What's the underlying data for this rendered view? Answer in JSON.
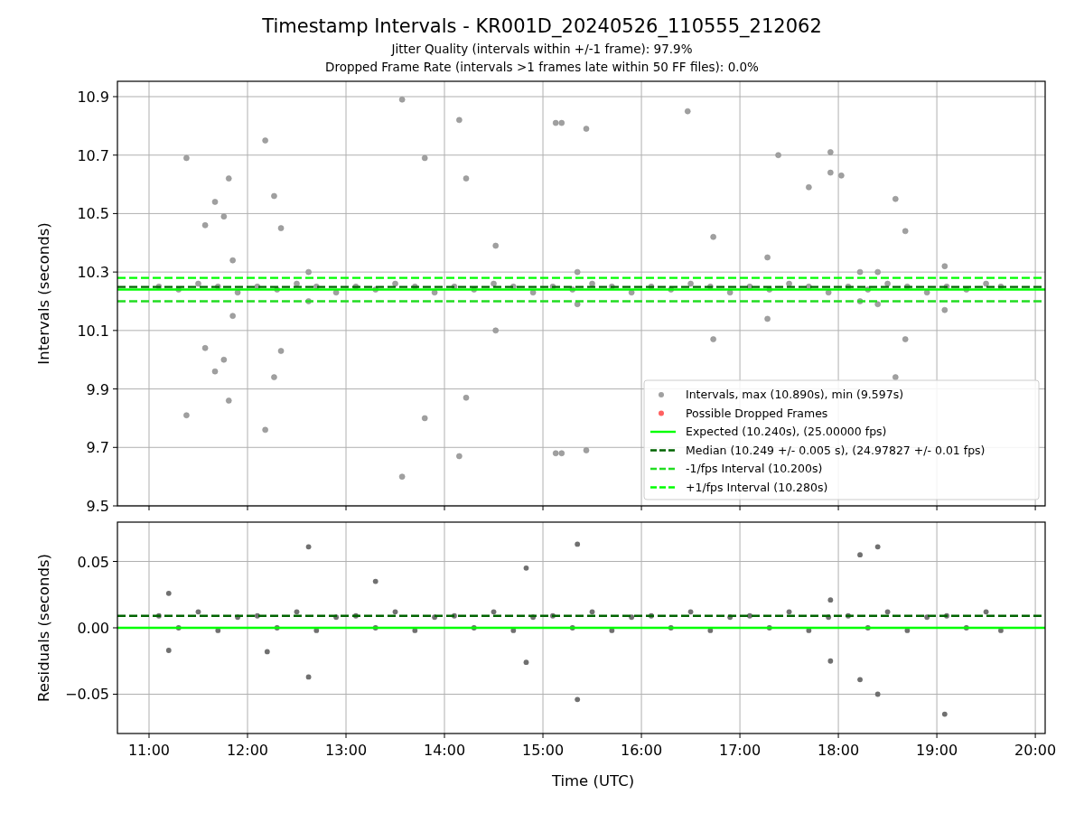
{
  "title": "Timestamp Intervals - KR001D_20240526_110555_212062",
  "subtitles": [
    "Jitter Quality (intervals within +/-1 frame): 97.9%",
    "Dropped Frame Rate (intervals >1 frames late within 50 FF files): 0.0%"
  ],
  "charts": [
    {
      "chart_data": {
        "type": "scatter",
        "ylabel": "Intervals (seconds)",
        "xlim": [
          10.679,
          20.1
        ],
        "ylim": [
          9.5,
          10.9525
        ],
        "yticks": [
          {
            "value": 9.5,
            "label": "9.5"
          },
          {
            "value": 9.7,
            "label": "9.7"
          },
          {
            "value": 9.9,
            "label": "9.9"
          },
          {
            "value": 10.1,
            "label": "10.1"
          },
          {
            "value": 10.3,
            "label": "10.3"
          },
          {
            "value": 10.5,
            "label": "10.5"
          },
          {
            "value": 10.7,
            "label": "10.7"
          },
          {
            "value": 10.9,
            "label": "10.9"
          }
        ],
        "series": [
          {
            "name": "Intervals, max (10.890s), min (9.597s)",
            "color": "#a0a0a0",
            "x": [
              11.38,
              11.38,
              11.57,
              11.57,
              11.67,
              11.67,
              11.76,
              11.76,
              11.81,
              11.81,
              11.85,
              11.85,
              12.18,
              12.18,
              12.27,
              12.27,
              12.34,
              12.34,
              12.62,
              12.62,
              13.57,
              13.57,
              13.8,
              13.8,
              14.15,
              14.15,
              14.22,
              14.22,
              14.52,
              14.52,
              15.13,
              15.13,
              15.19,
              15.19,
              15.35,
              15.35,
              15.44,
              15.44,
              16.47,
              16.73,
              16.73,
              17.28,
              17.28,
              17.39,
              17.7,
              17.92,
              17.92,
              18.03,
              18.22,
              18.22,
              18.4,
              18.4,
              18.58,
              18.58,
              18.68,
              18.68,
              19.08,
              19.08,
              11.1,
              11.3,
              11.5,
              11.7,
              11.9,
              12.1,
              12.3,
              12.5,
              12.7,
              12.9,
              13.1,
              13.3,
              13.5,
              13.7,
              13.9,
              14.1,
              14.3,
              14.5,
              14.7,
              14.9,
              15.1,
              15.3,
              15.5,
              15.7,
              15.9,
              16.1,
              16.3,
              16.5,
              16.7,
              16.9,
              17.1,
              17.3,
              17.5,
              17.7,
              17.9,
              18.1,
              18.3,
              18.5,
              18.7,
              18.9,
              19.1,
              19.3,
              19.5,
              19.65
            ],
            "values": [
              10.69,
              9.81,
              10.46,
              10.04,
              10.54,
              9.96,
              10.49,
              10.0,
              10.62,
              9.86,
              10.34,
              10.15,
              10.75,
              9.76,
              10.56,
              9.94,
              10.45,
              10.03,
              10.3,
              10.2,
              10.89,
              9.6,
              10.69,
              9.8,
              10.82,
              9.67,
              10.62,
              9.87,
              10.39,
              10.1,
              10.81,
              9.68,
              10.81,
              9.68,
              10.3,
              10.19,
              10.79,
              9.69,
              10.85,
              10.42,
              10.07,
              10.35,
              10.14,
              10.7,
              10.59,
              10.71,
              10.64,
              10.63,
              10.3,
              10.2,
              10.3,
              10.19,
              10.55,
              9.94,
              10.44,
              10.07,
              10.32,
              10.17,
              10.25,
              10.24,
              10.26,
              10.25,
              10.23,
              10.25,
              10.24,
              10.26,
              10.25,
              10.23,
              10.25,
              10.24,
              10.26,
              10.25,
              10.23,
              10.25,
              10.24,
              10.26,
              10.25,
              10.23,
              10.25,
              10.24,
              10.26,
              10.25,
              10.23,
              10.25,
              10.24,
              10.26,
              10.25,
              10.23,
              10.25,
              10.24,
              10.26,
              10.25,
              10.23,
              10.25,
              10.24,
              10.26,
              10.25,
              10.23,
              10.25,
              10.24,
              10.26,
              10.25
            ]
          },
          {
            "name": "Possible Dropped Frames",
            "color": "#ff6060"
          },
          {
            "name": "Expected (10.240s), (25.00000 fps)",
            "type": "line",
            "color": "#00ff00",
            "x": [
              10.679,
              20.1
            ],
            "values": [
              10.24,
              10.24
            ]
          },
          {
            "name": "Median (10.249 +/- 0.005 s), (24.97827 +/- 0.01 fps)",
            "type": "line",
            "line_style": "dashed",
            "color": "#006400",
            "x": [
              10.679,
              20.1
            ],
            "values": [
              10.249,
              10.249
            ]
          },
          {
            "name": "-1/fps Interval (10.200s)",
            "type": "line",
            "line_style": "dashed",
            "color": "#22dd22",
            "x": [
              10.679,
              20.1
            ],
            "values": [
              10.2,
              10.2
            ]
          },
          {
            "name": "+1/fps Interval (10.280s)",
            "type": "line",
            "line_style": "dashed",
            "color": "#00ff00",
            "x": [
              10.679,
              20.1
            ],
            "values": [
              10.28,
              10.28
            ]
          }
        ],
        "grid": true,
        "legend": true
      }
    },
    {
      "chart_data": {
        "type": "scatter",
        "xlabel": "Time (UTC)",
        "ylabel": "Residuals (seconds)",
        "xlim": [
          10.679,
          20.1
        ],
        "ylim": [
          -0.0796,
          0.0796
        ],
        "xticks": [
          {
            "value": 11,
            "label": "11:00"
          },
          {
            "value": 12,
            "label": "12:00"
          },
          {
            "value": 13,
            "label": "13:00"
          },
          {
            "value": 14,
            "label": "14:00"
          },
          {
            "value": 15,
            "label": "15:00"
          },
          {
            "value": 16,
            "label": "16:00"
          },
          {
            "value": 17,
            "label": "17:00"
          },
          {
            "value": 18,
            "label": "18:00"
          },
          {
            "value": 19,
            "label": "19:00"
          },
          {
            "value": 20,
            "label": "20:00"
          }
        ],
        "yticks": [
          {
            "value": -0.05,
            "label": "−0.05"
          },
          {
            "value": 0,
            "label": "0.00"
          },
          {
            "value": 0.05,
            "label": "0.05"
          }
        ],
        "series": [
          {
            "color": "#707070",
            "x": [
              12.62,
              12.62,
              15.35,
              15.35,
              18.4,
              18.4,
              18.22,
              18.22,
              19.08,
              14.83,
              14.83,
              11.2,
              11.2,
              13.3,
              12.2,
              17.92,
              17.92,
              11.1,
              11.3,
              11.5,
              11.7,
              11.9,
              12.1,
              12.3,
              12.5,
              12.7,
              12.9,
              13.1,
              13.3,
              13.5,
              13.7,
              13.9,
              14.1,
              14.3,
              14.5,
              14.7,
              14.9,
              15.1,
              15.3,
              15.5,
              15.7,
              15.9,
              16.1,
              16.3,
              16.5,
              16.7,
              16.9,
              17.1,
              17.3,
              17.5,
              17.7,
              17.9,
              18.1,
              18.3,
              18.5,
              18.7,
              18.9,
              19.1,
              19.3,
              19.5,
              19.65
            ],
            "values": [
              0.061,
              -0.037,
              0.063,
              -0.054,
              0.061,
              -0.05,
              0.055,
              -0.039,
              -0.065,
              0.045,
              -0.026,
              0.026,
              -0.017,
              0.035,
              -0.018,
              -0.025,
              0.021,
              0.009,
              0.0,
              0.012,
              -0.002,
              0.008,
              0.009,
              0.0,
              0.012,
              -0.002,
              0.008,
              0.009,
              0.0,
              0.012,
              -0.002,
              0.008,
              0.009,
              0.0,
              0.012,
              -0.002,
              0.008,
              0.009,
              0.0,
              0.012,
              -0.002,
              0.008,
              0.009,
              0.0,
              0.012,
              -0.002,
              0.008,
              0.009,
              0.0,
              0.012,
              -0.002,
              0.008,
              0.009,
              0.0,
              0.012,
              -0.002,
              0.008,
              0.009,
              0.0,
              0.012,
              -0.002
            ]
          },
          {
            "type": "line",
            "color": "#00ff00",
            "x": [
              10.679,
              20.1
            ],
            "values": [
              0,
              0
            ]
          },
          {
            "type": "line",
            "line_style": "dashed",
            "color": "#006400",
            "x": [
              10.679,
              20.1
            ],
            "values": [
              0.009,
              0.009
            ]
          }
        ],
        "grid": true
      }
    }
  ]
}
